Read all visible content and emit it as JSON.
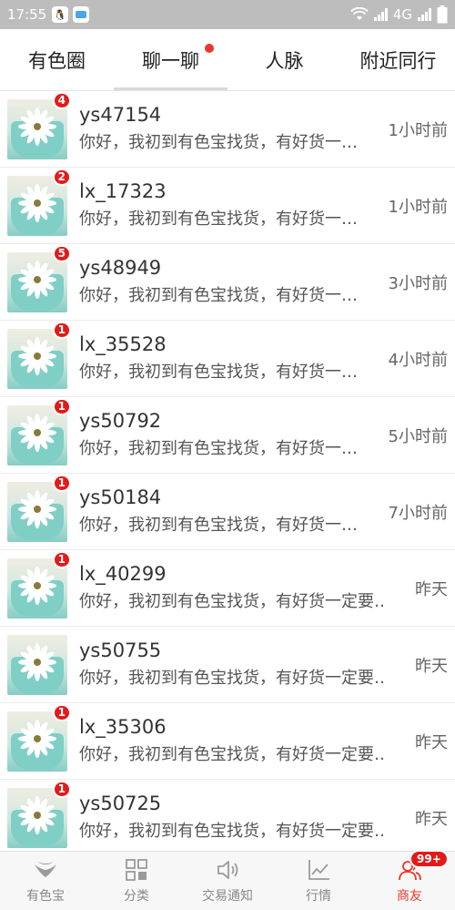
{
  "status_bar": {
    "time": "17:55",
    "network": "4G"
  },
  "tabs": [
    {
      "label": "有色圈",
      "active": false
    },
    {
      "label": "聊一聊",
      "active": true,
      "dot": true
    },
    {
      "label": "人脉",
      "active": false
    },
    {
      "label": "附近同行",
      "active": false
    }
  ],
  "chats": [
    {
      "name": "ys47154",
      "message": "你好，我初到有色宝找货，有好货一…",
      "time": "1小时前",
      "unread": "4"
    },
    {
      "name": "lx_17323",
      "message": "你好，我初到有色宝找货，有好货一…",
      "time": "1小时前",
      "unread": "2"
    },
    {
      "name": "ys48949",
      "message": "你好，我初到有色宝找货，有好货一…",
      "time": "3小时前",
      "unread": "5"
    },
    {
      "name": "lx_35528",
      "message": "你好，我初到有色宝找货，有好货一…",
      "time": "4小时前",
      "unread": "1"
    },
    {
      "name": "ys50792",
      "message": "你好，我初到有色宝找货，有好货一…",
      "time": "5小时前",
      "unread": "1"
    },
    {
      "name": "ys50184",
      "message": "你好，我初到有色宝找货，有好货一…",
      "time": "7小时前",
      "unread": "1"
    },
    {
      "name": "lx_40299",
      "message": "你好，我初到有色宝找货，有好货一定要…",
      "time": "昨天",
      "unread": "1"
    },
    {
      "name": "ys50755",
      "message": "你好，我初到有色宝找货，有好货一定要…",
      "time": "昨天",
      "unread": ""
    },
    {
      "name": "lx_35306",
      "message": "你好，我初到有色宝找货，有好货一定要…",
      "time": "昨天",
      "unread": "1"
    },
    {
      "name": "ys50725",
      "message": "你好，我初到有色宝找货，有好货一定要…",
      "time": "昨天",
      "unread": "1"
    }
  ],
  "bottom_nav": [
    {
      "label": "有色宝",
      "icon": "logo-icon",
      "active": false
    },
    {
      "label": "分类",
      "icon": "grid-icon",
      "active": false
    },
    {
      "label": "交易通知",
      "icon": "speaker-icon",
      "active": false
    },
    {
      "label": "行情",
      "icon": "chart-icon",
      "active": false
    },
    {
      "label": "商友",
      "icon": "contacts-icon",
      "active": true,
      "badge": "99+"
    }
  ],
  "colors": {
    "accent": "#e8382b",
    "badge": "#e31a1a",
    "status_bar": "#bdbdbd"
  }
}
